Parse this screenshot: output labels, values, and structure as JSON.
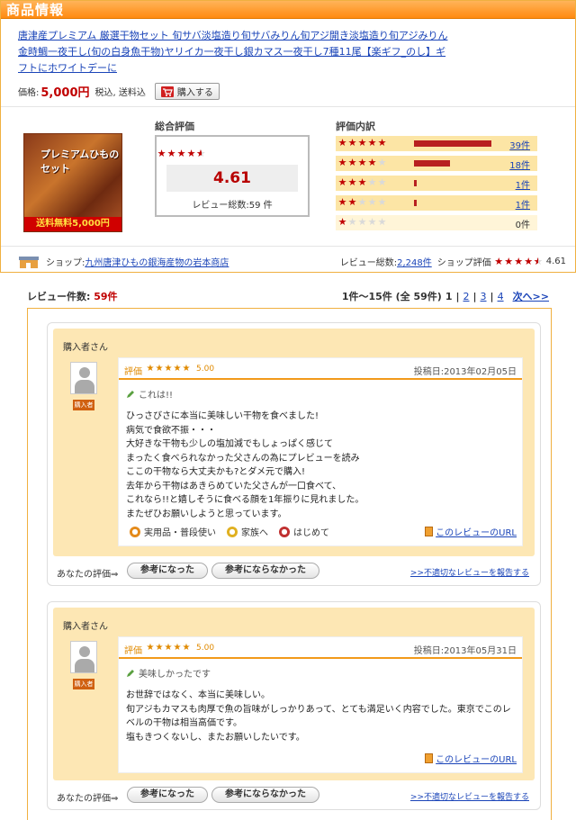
{
  "product": {
    "section_title": "商品情報",
    "name_line1": "唐津産プレミアム 厳選干物セット 旬サバ淡塩造り旬サバみりん旬アジ開き淡塩造り旬アジみりん",
    "name_line2": "金時鯛一夜干し(旬の白身魚干物)ヤリイカ一夜干し銀カマス一夜干し7種11尾【楽ギフ_のし】ギ",
    "name_line3": "フトにホワイトデーに",
    "price_label": "価格:",
    "price_value": "5,000円",
    "tax_label": "税込, 送料込",
    "buy_label": "購入する",
    "image_caption": "プレミアムひもの セット",
    "image_banner": "送料無料5,000円"
  },
  "overall": {
    "title": "総合評価",
    "score": "4.61",
    "stars": 4.5,
    "review_count": "レビュー総数:59 件"
  },
  "breakdown": {
    "title": "評価内訳",
    "rows": [
      {
        "stars": 5,
        "count": "39件",
        "fraction": 0.66
      },
      {
        "stars": 4,
        "count": "18件",
        "fraction": 0.31
      },
      {
        "stars": 3,
        "count": "1件",
        "fraction": 0.02
      },
      {
        "stars": 2,
        "count": "1件",
        "fraction": 0.02
      },
      {
        "stars": 1,
        "count": "0件",
        "fraction": 0
      }
    ]
  },
  "shop": {
    "label": "ショップ:",
    "name": "九州唐津ひもの銀海産物の岩本商店",
    "total_label": "レビュー総数:",
    "total_value": "2,248件",
    "eval_label": "ショップ評価",
    "eval_score": "4.61"
  },
  "review_list": {
    "count_label": "レビュー件数:",
    "count_value": "59件",
    "range": "1件〜15件 (全 59件)",
    "current_page": "1",
    "pages": [
      "2",
      "3",
      "4"
    ],
    "next": "次へ>>"
  },
  "reviews": [
    {
      "reviewer": "購入者さん",
      "badge": "購入者",
      "rating_label": "評価",
      "rating": "5.00",
      "date": "投稿日:2013年02月05日",
      "title": "これは!!",
      "text": "ひっさびさに本当に美味しい干物を食べました!\n病気で食欲不振・・・\n大好きな干物も少しの塩加減でもしょっぱく感じて\nまったく食べられなかった父さんの為にプレビューを読み\nここの干物なら大丈夫かも?とダメ元で購入!\n去年から干物はあきらめていた父さんが一口食べて、\nこれなら!!と嬉しそうに食べる顔を1年振りに見れました。\nまたぜひお願いしようと思っています。",
      "tags": [
        "実用品・普段使い",
        "家族へ",
        "はじめて"
      ],
      "url_label": "このレビューのURL"
    },
    {
      "reviewer": "購入者さん",
      "badge": "購入者",
      "rating_label": "評価",
      "rating": "5.00",
      "date": "投稿日:2013年05月31日",
      "title": "美味しかったです",
      "text": "お世辞ではなく、本当に美味しい。\n旬アジもカマスも肉厚で魚の旨味がしっかりあって、とても満足いく内容でした。東京でこのレ\nベルの干物は相当高価です。\n塩もきつくないし、またお願いしたいです。",
      "tags": [],
      "url_label": "このレビューのURL"
    }
  ],
  "vote": {
    "your_eval": "あなたの評価⇒",
    "helpful": "参考になった",
    "not_helpful": "参考にならなかった",
    "report": ">>不適切なレビューを報告する"
  }
}
